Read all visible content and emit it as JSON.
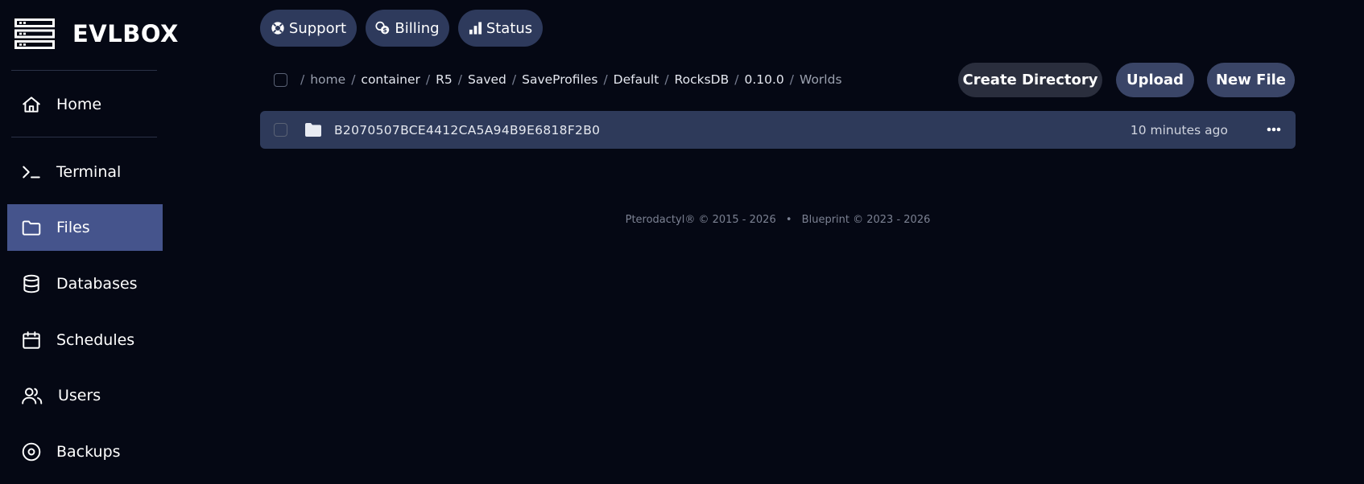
{
  "brand": {
    "name": "EVLBOX"
  },
  "sidebar": {
    "items": [
      {
        "label": "Home",
        "icon": "home-icon"
      },
      {
        "label": "Terminal",
        "icon": "terminal-icon"
      },
      {
        "label": "Files",
        "icon": "folder-icon",
        "active": true
      },
      {
        "label": "Databases",
        "icon": "database-icon"
      },
      {
        "label": "Schedules",
        "icon": "calendar-icon"
      },
      {
        "label": "Users",
        "icon": "users-icon"
      },
      {
        "label": "Backups",
        "icon": "backup-icon"
      }
    ]
  },
  "top_links": [
    {
      "label": "Support",
      "icon": "lifebuoy-icon"
    },
    {
      "label": "Billing",
      "icon": "coins-icon"
    },
    {
      "label": "Status",
      "icon": "bar-chart-icon"
    }
  ],
  "breadcrumb": {
    "separator": "/",
    "items": [
      "home",
      "container",
      "R5",
      "Saved",
      "SaveProfiles",
      "Default",
      "RocksDB",
      "0.10.0",
      "Worlds"
    ]
  },
  "actions": {
    "create_directory": "Create Directory",
    "upload": "Upload",
    "new_file": "New File"
  },
  "files": [
    {
      "name": "B2070507BCE4412CA5A94B9E6818F2B0",
      "modified": "10 minutes ago",
      "type": "directory"
    }
  ],
  "footer": {
    "pterodactyl": "Pterodactyl® © 2015 - 2026",
    "separator": "•",
    "blueprint": "Blueprint © 2023 - 2026"
  },
  "colors": {
    "background": "#050814",
    "sidebar_active": "#45548c",
    "pill": "#2e3a5c",
    "file_row": "#2e3a5a",
    "button_dark": "#2a2e3d",
    "button_blue": "#3a4567"
  }
}
